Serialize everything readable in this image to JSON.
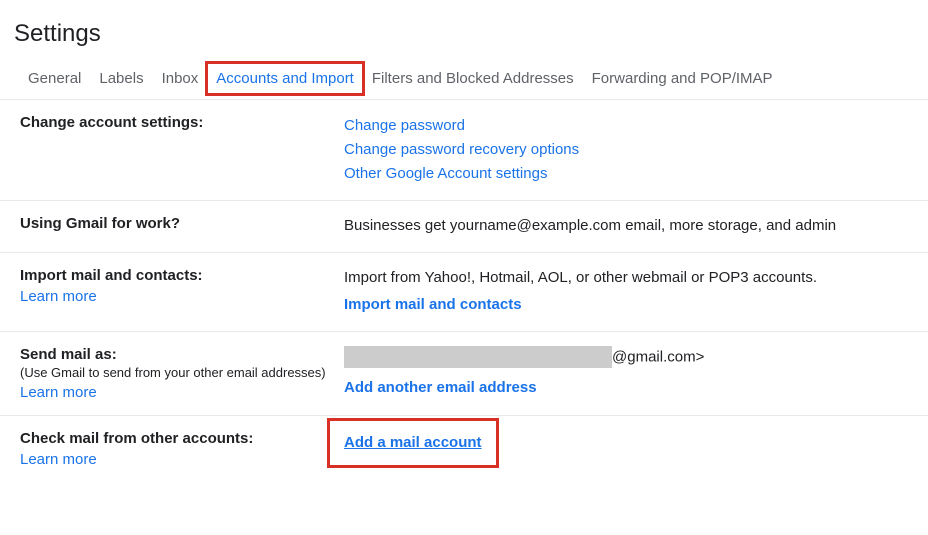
{
  "title": "Settings",
  "tabs": {
    "general": "General",
    "labels": "Labels",
    "inbox": "Inbox",
    "accounts": "Accounts and Import",
    "filters": "Filters and Blocked Addresses",
    "forwarding": "Forwarding and POP/IMAP"
  },
  "section1": {
    "label": "Change account settings:",
    "link1": "Change password",
    "link2": "Change password recovery options",
    "link3": "Other Google Account settings"
  },
  "section2": {
    "label": "Using Gmail for work?",
    "text": "Businesses get yourname@example.com email, more storage, and admin "
  },
  "section3": {
    "label": "Import mail and contacts:",
    "learn": "Learn more",
    "text": "Import from Yahoo!, Hotmail, AOL, or other webmail or POP3 accounts.",
    "link": "Import mail and contacts"
  },
  "section4": {
    "label": "Send mail as:",
    "sub": "(Use Gmail to send from your other email addresses)",
    "learn": "Learn more",
    "suffix": "@gmail.com>",
    "link": "Add another email address"
  },
  "section5": {
    "label": "Check mail from other accounts:",
    "learn": "Learn more",
    "link": "Add a mail account"
  }
}
